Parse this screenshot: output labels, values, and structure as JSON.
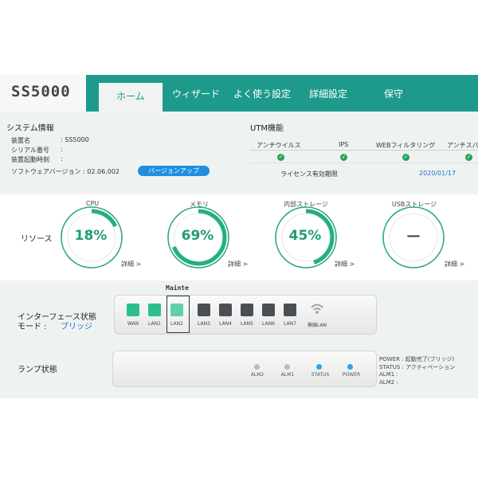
{
  "header": {
    "brand": "SS5000",
    "tabs": [
      {
        "label": "ホーム",
        "active": true
      },
      {
        "label": "ウィザード"
      },
      {
        "label": "よく使う設定"
      },
      {
        "label": "詳細設定"
      },
      {
        "label": "保守"
      }
    ],
    "color": "#1d9a8b"
  },
  "system_info": {
    "title": "システム情報",
    "rows": [
      {
        "label": "装置名",
        "value": ": SS5000"
      },
      {
        "label": "シリアル番号",
        "value": ":"
      },
      {
        "label": "装置起動時刻",
        "value": ":"
      }
    ],
    "firmware_label": "ソフトウェアバージョン : 02.06.002",
    "update_button": "バージョンアップ"
  },
  "utm": {
    "title": "UTM機能",
    "columns": [
      "アンチウイルス",
      "IPS",
      "WEBフィルタリング",
      "アンチスパム"
    ],
    "license_label": "ライセンス有効期限",
    "license_date": "2020/01/17"
  },
  "resources": {
    "title": "リソース",
    "gauges": [
      {
        "name": "CPU",
        "value": 0.18,
        "text": "18%",
        "detail": "詳細 >"
      },
      {
        "name": "メモリ",
        "value": 0.69,
        "text": "69%",
        "detail": "詳細 >"
      },
      {
        "name": "内部ストレージ",
        "value": 0.45,
        "text": "45%",
        "detail": "詳細 >"
      },
      {
        "name": "USBストレージ",
        "value": 0,
        "text": "—",
        "detail": "詳細 >"
      }
    ],
    "gauge_color": "#22b07a"
  },
  "interface": {
    "title": "インターフェース状態",
    "mode_label": "モード :",
    "mode_value": "ブリッジ",
    "tooltip": "Mainte",
    "ports": [
      {
        "label": "WAN",
        "state": "up"
      },
      {
        "label": "LAN1",
        "state": "up"
      },
      {
        "label": "LAN2",
        "state": "up"
      },
      {
        "label": "LAN3",
        "state": "down"
      },
      {
        "label": "LAN4",
        "state": "down"
      },
      {
        "label": "LAN5",
        "state": "down"
      },
      {
        "label": "LAN6",
        "state": "down"
      },
      {
        "label": "LAN7",
        "state": "down"
      },
      {
        "label": "無線LAN",
        "state": "wifi"
      }
    ]
  },
  "lamps": {
    "title": "ランプ状態",
    "items": [
      {
        "label": "ALM2",
        "color": "#bbbbbb"
      },
      {
        "label": "ALM1",
        "color": "#bbbbbb"
      },
      {
        "label": "STATUS",
        "color": "#2aa7e8"
      },
      {
        "label": "POWER",
        "color": "#2aa7e8"
      }
    ],
    "legend": [
      "POWER : 起動完了(ブリッジ)",
      "STATUS : アクティベーション",
      "ALM1 :",
      "ALM2 :"
    ]
  }
}
